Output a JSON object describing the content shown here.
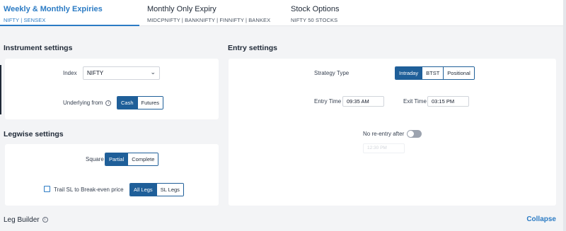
{
  "tabs": [
    {
      "title": "Weekly & Monthly Expiries",
      "subtitle": "NIFTY | SENSEX"
    },
    {
      "title": "Monthly Only Expiry",
      "subtitle": "MIDCPNIFTY | BANKNIFTY | FINNIFTY | BANKEX"
    },
    {
      "title": "Stock Options",
      "subtitle": "NIFTY 50 STOCKS"
    }
  ],
  "instrument": {
    "title": "Instrument settings",
    "index_label": "Index",
    "index_value": "NIFTY",
    "underlying_label": "Underlying from",
    "underlying_options": [
      "Cash",
      "Futures"
    ],
    "underlying_selected": "Cash"
  },
  "legwise": {
    "title": "Legwise settings",
    "square_off_label": "Square Off",
    "square_off_options": [
      "Partial",
      "Complete"
    ],
    "square_off_selected": "Partial",
    "trail_label": "Trail SL to Break-even price",
    "trail_options": [
      "All Legs",
      "SL Legs"
    ],
    "trail_selected": "All Legs"
  },
  "entry": {
    "title": "Entry settings",
    "strategy_label": "Strategy Type",
    "strategy_options": [
      "Intraday",
      "BTST",
      "Positional"
    ],
    "strategy_selected": "Intraday",
    "entry_time_label": "Entry Time",
    "entry_time": "09:35 AM",
    "exit_time_label": "Exit Time",
    "exit_time": "03:15 PM",
    "no_reentry_label": "No re-entry after",
    "no_reentry_time": "12:30 PM"
  },
  "leg_builder": {
    "title": "Leg Builder",
    "collapse_label": "Collapse"
  },
  "colors": {
    "accent": "#2b7bc4",
    "selected_fill": "#1f5f99",
    "background": "#f3f4f6"
  }
}
